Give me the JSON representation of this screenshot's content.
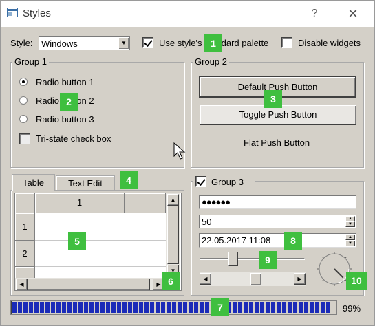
{
  "window": {
    "title": "Styles",
    "help_glyph": "?",
    "close_glyph": "✕"
  },
  "toolbar": {
    "style_label": "Style:",
    "style_value": "Windows",
    "palette_label": "Use style's standard palette",
    "palette_checked": true,
    "disable_label": "Disable widgets",
    "disable_checked": false
  },
  "group1": {
    "title": "Group 1",
    "radios": [
      {
        "label": "Radio button 1",
        "checked": true
      },
      {
        "label": "Radio button 2",
        "checked": false
      },
      {
        "label": "Radio button 3",
        "checked": false
      }
    ],
    "tristate_label": "Tri-state check box"
  },
  "group2": {
    "title": "Group 2",
    "default_button": "Default Push Button",
    "toggle_button": "Toggle Push Button",
    "flat_button": "Flat Push Button"
  },
  "tabs": {
    "items": [
      "Table",
      "Text Edit"
    ],
    "active": 0,
    "table": {
      "column_headers": [
        "1"
      ],
      "row_headers": [
        "1",
        "2"
      ]
    }
  },
  "group3": {
    "title": "Group 3",
    "checked": true,
    "password": "●●●●●●",
    "spin_value": "50",
    "datetime": "22.05.2017 11:08",
    "slider_fraction": 0.3,
    "hscroll_fraction": 0.55,
    "dial_angle_deg": 135
  },
  "progress": {
    "value_text": "99%",
    "fraction": 0.99,
    "color": "#1a2bb8"
  },
  "badges": [
    "1",
    "2",
    "3",
    "4",
    "5",
    "6",
    "7",
    "8",
    "9",
    "10"
  ],
  "badge_color": "#3fbf3f"
}
